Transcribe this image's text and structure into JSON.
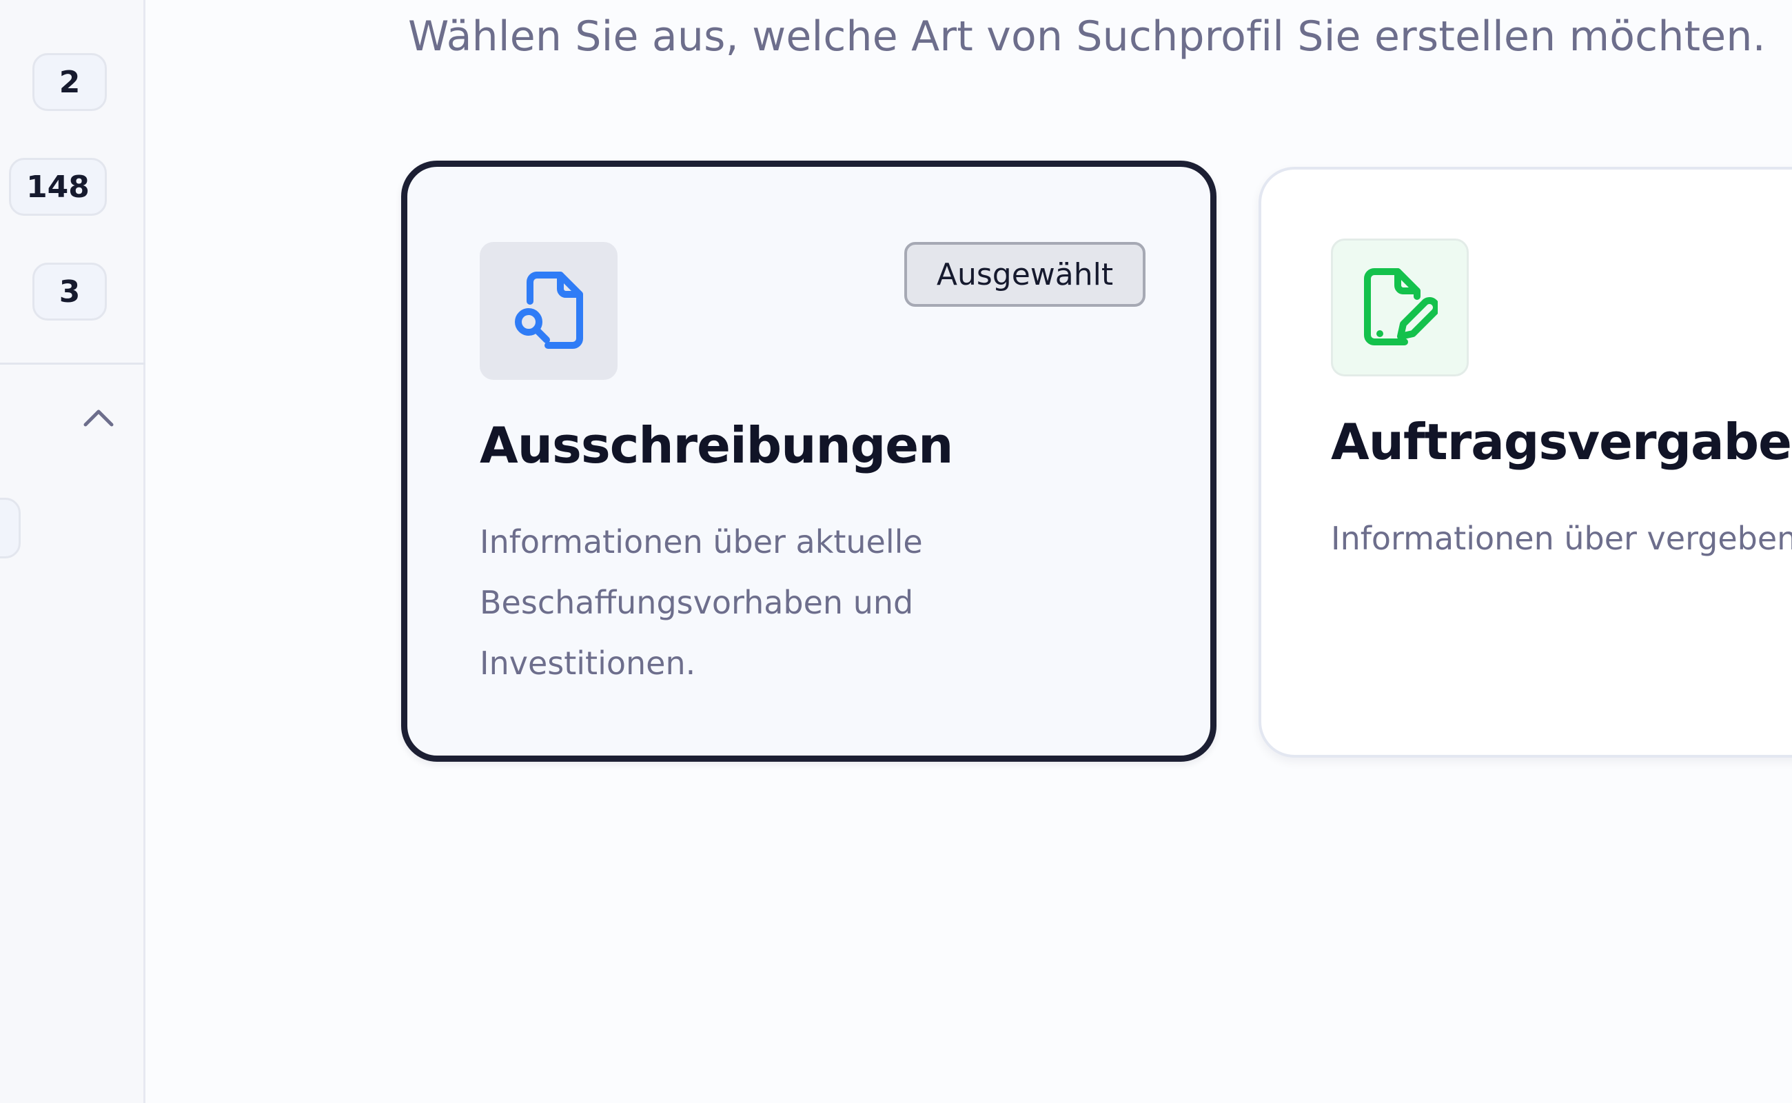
{
  "sidebar": {
    "badges": [
      "2",
      "148",
      "3"
    ],
    "collapse_icon": "chevron-up-icon"
  },
  "main": {
    "subtitle": "Wählen Sie aus, welche Art von Suchprofil Sie erstellen möchten.",
    "cards": [
      {
        "title": "Ausschreibungen",
        "description": "Informationen über aktuelle Beschaffungsvorhaben und Investitionen.",
        "selected_label": "Ausgewählt",
        "icon": "file-search-icon",
        "icon_color": "#2f7cf6"
      },
      {
        "title": "Auftragsvergaben",
        "description": "Informationen über vergeben",
        "icon": "file-edit-icon",
        "icon_color": "#14c14c"
      }
    ]
  },
  "colors": {
    "text_primary": "#111427",
    "text_muted": "#6d6e8c",
    "selected_border": "#1c1f33"
  }
}
